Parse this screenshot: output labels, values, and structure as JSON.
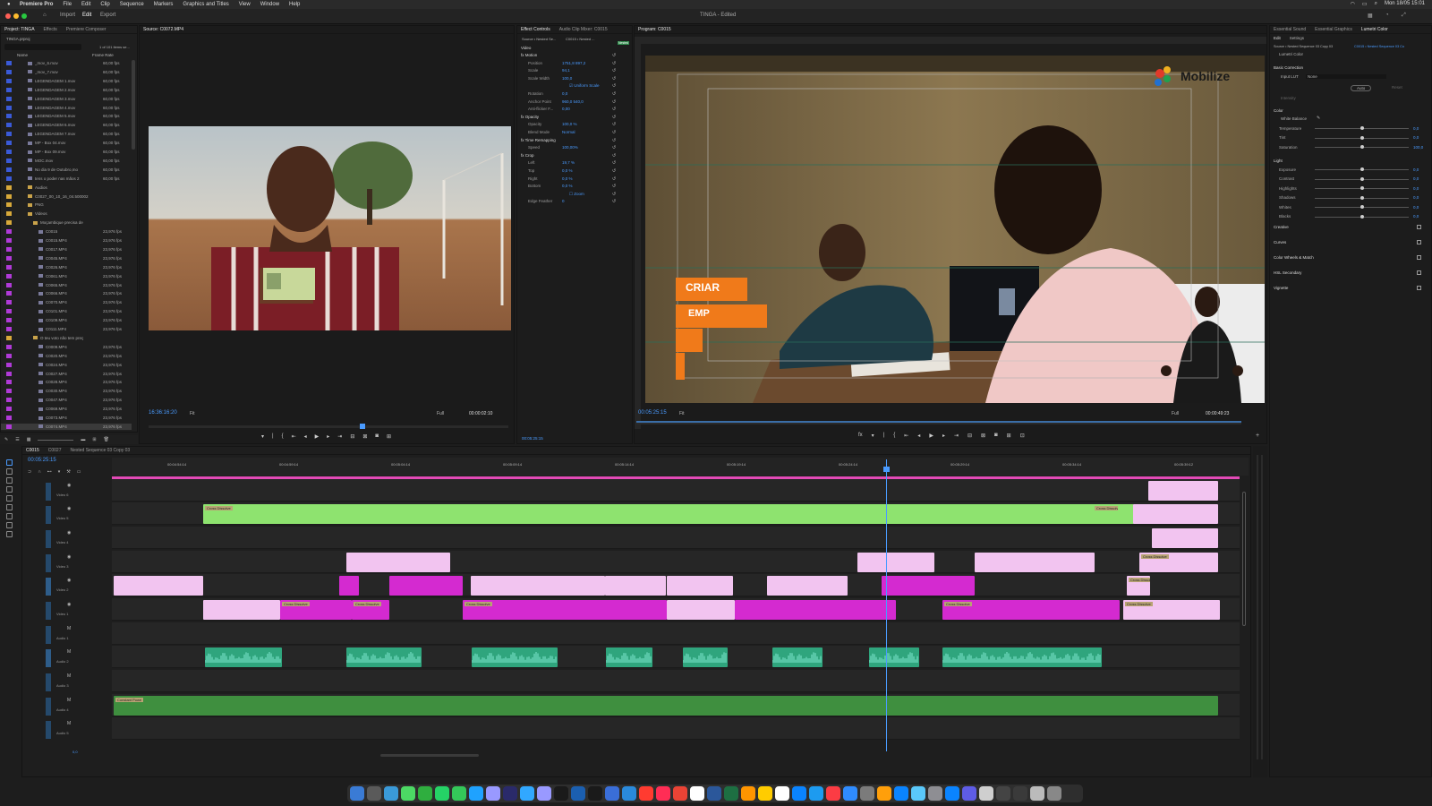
{
  "menubar": {
    "apple": "",
    "app": "Premiere Pro",
    "items": [
      "File",
      "Edit",
      "Clip",
      "Sequence",
      "Markers",
      "Graphics and Titles",
      "View",
      "Window",
      "Help"
    ],
    "clock": "Mon 18/05 15:01"
  },
  "workspace": {
    "modes": [
      "Import",
      "Edit",
      "Export"
    ],
    "active": "Edit",
    "title": "TINGA - Edited"
  },
  "project": {
    "tabs": [
      "Project: TINGA",
      "Effects",
      "Premiere Composer"
    ],
    "name": "TINGA.prproj",
    "count": "1 of 101 items se...",
    "columns": [
      "Name",
      "Frame Rate"
    ],
    "rows": [
      {
        "name": "_mov_6.mov",
        "rate": "60,00 fps",
        "color": "#3a5ad8",
        "indent": 0
      },
      {
        "name": "_mov_7.mov",
        "rate": "60,00 fps",
        "color": "#3a5ad8",
        "indent": 0
      },
      {
        "name": "LEGENDAGEM 1.mov",
        "rate": "60,00 fps",
        "color": "#3a5ad8",
        "indent": 0
      },
      {
        "name": "LEGENDAGEM 2.mov",
        "rate": "60,00 fps",
        "color": "#3a5ad8",
        "indent": 0
      },
      {
        "name": "LEGENDAGEM 3.mov",
        "rate": "60,00 fps",
        "color": "#3a5ad8",
        "indent": 0
      },
      {
        "name": "LEGENDAGEM 4.mov",
        "rate": "60,00 fps",
        "color": "#3a5ad8",
        "indent": 0
      },
      {
        "name": "LEGENDAGEM 5.mov",
        "rate": "60,00 fps",
        "color": "#3a5ad8",
        "indent": 0
      },
      {
        "name": "LEGENDAGEM 6.mov",
        "rate": "60,00 fps",
        "color": "#3a5ad8",
        "indent": 0
      },
      {
        "name": "LEGENDAGEM 7.mov",
        "rate": "60,00 fps",
        "color": "#3a5ad8",
        "indent": 0
      },
      {
        "name": "MP - Box 04.mov",
        "rate": "60,00 fps",
        "color": "#3a5ad8",
        "indent": 0
      },
      {
        "name": "MP - Box 09.mov",
        "rate": "60,00 fps",
        "color": "#3a5ad8",
        "indent": 0
      },
      {
        "name": "MOC.mov",
        "rate": "60,00 fps",
        "color": "#3a5ad8",
        "indent": 0
      },
      {
        "name": "No dia 9 de Outubro,mo",
        "rate": "60,00 fps",
        "color": "#3a5ad8",
        "indent": 0
      },
      {
        "name": "tens o poder nas mãos 2",
        "rate": "60,00 fps",
        "color": "#3a5ad8",
        "indent": 0
      },
      {
        "name": "Audios",
        "rate": "",
        "color": "#d8a93a",
        "indent": 0
      },
      {
        "name": "C0027_00_10_16_04.500002",
        "rate": "",
        "color": "#d8a93a",
        "indent": 0
      },
      {
        "name": "PNG",
        "rate": "",
        "color": "#d8a93a",
        "indent": 0
      },
      {
        "name": "Videos",
        "rate": "",
        "color": "#d8a93a",
        "indent": 0
      },
      {
        "name": "Moçambique precisa de",
        "rate": "",
        "color": "#d8a93a",
        "indent": 1
      },
      {
        "name": "C0015",
        "rate": "23,976 fps",
        "color": "#b03ad8",
        "indent": 2
      },
      {
        "name": "C0015.MP4",
        "rate": "23,976 fps",
        "color": "#b03ad8",
        "indent": 2
      },
      {
        "name": "C0017.MP4",
        "rate": "23,976 fps",
        "color": "#b03ad8",
        "indent": 2
      },
      {
        "name": "C0045.MP4",
        "rate": "23,976 fps",
        "color": "#b03ad8",
        "indent": 2
      },
      {
        "name": "C0026.MP4",
        "rate": "23,976 fps",
        "color": "#b03ad8",
        "indent": 2
      },
      {
        "name": "C0061.MP4",
        "rate": "23,976 fps",
        "color": "#b03ad8",
        "indent": 2
      },
      {
        "name": "C0065.MP4",
        "rate": "23,976 fps",
        "color": "#b03ad8",
        "indent": 2
      },
      {
        "name": "C0066.MP4",
        "rate": "23,976 fps",
        "color": "#b03ad8",
        "indent": 2
      },
      {
        "name": "C0070.MP4",
        "rate": "23,976 fps",
        "color": "#b03ad8",
        "indent": 2
      },
      {
        "name": "C0101.MP4",
        "rate": "23,976 fps",
        "color": "#b03ad8",
        "indent": 2
      },
      {
        "name": "C0109.MP4",
        "rate": "23,976 fps",
        "color": "#b03ad8",
        "indent": 2
      },
      {
        "name": "C0111.MP4",
        "rate": "23,976 fps",
        "color": "#b03ad8",
        "indent": 2
      },
      {
        "name": "O teu voto não tem preç",
        "rate": "",
        "color": "#d8a93a",
        "indent": 1
      },
      {
        "name": "C0009.MP4",
        "rate": "23,976 fps",
        "color": "#b03ad8",
        "indent": 2
      },
      {
        "name": "C0020.MP4",
        "rate": "23,976 fps",
        "color": "#b03ad8",
        "indent": 2
      },
      {
        "name": "C0024.MP4",
        "rate": "23,976 fps",
        "color": "#b03ad8",
        "indent": 2
      },
      {
        "name": "C0027.MP4",
        "rate": "23,976 fps",
        "color": "#b03ad8",
        "indent": 2
      },
      {
        "name": "C0028.MP4",
        "rate": "23,976 fps",
        "color": "#b03ad8",
        "indent": 2
      },
      {
        "name": "C0030.MP4",
        "rate": "23,976 fps",
        "color": "#b03ad8",
        "indent": 2
      },
      {
        "name": "C0047.MP4",
        "rate": "23,976 fps",
        "color": "#b03ad8",
        "indent": 2
      },
      {
        "name": "C0069.MP4",
        "rate": "23,976 fps",
        "color": "#b03ad8",
        "indent": 2
      },
      {
        "name": "C0073.MP4",
        "rate": "23,976 fps",
        "color": "#b03ad8",
        "indent": 2
      },
      {
        "name": "C0074.MP4",
        "rate": "23,976 fps",
        "color": "#b03ad8",
        "indent": 2
      }
    ]
  },
  "source": {
    "tab": "Source: C0072.MP4",
    "timecode": "16:36:16:20",
    "fit": "Fit",
    "quality": "Full",
    "duration": "00:00:02:10"
  },
  "effect_controls": {
    "tabs": [
      "Effect Controls",
      "Audio Clip Mixer: C0015"
    ],
    "source": "Source • Nested Se...",
    "seq": "C0015 • Nested ...",
    "badge": "Nested",
    "section": "Video",
    "rows": [
      {
        "label": "fx  Motion",
        "value": "",
        "level": 0
      },
      {
        "label": "Position",
        "value": "1751,8    897,2",
        "level": 1
      },
      {
        "label": "Scale",
        "value": "94,1",
        "level": 1
      },
      {
        "label": "Scale Width",
        "value": "100,0",
        "level": 1
      },
      {
        "label": "",
        "value": "☑ Uniform Scale",
        "level": 2
      },
      {
        "label": "Rotation",
        "value": "0,0",
        "level": 1
      },
      {
        "label": "Anchor Point",
        "value": "960,0    540,0",
        "level": 1
      },
      {
        "label": "Anti-flicker F...",
        "value": "0,00",
        "level": 1
      },
      {
        "label": "fx  Opacity",
        "value": "",
        "level": 0
      },
      {
        "label": "Opacity",
        "value": "100,0 %",
        "level": 1
      },
      {
        "label": "Blend Mode",
        "value": "Normal",
        "level": 1
      },
      {
        "label": "fx  Time Remapping",
        "value": "",
        "level": 0
      },
      {
        "label": "Speed",
        "value": "100,00%",
        "level": 1
      },
      {
        "label": "fx  Crop",
        "value": "",
        "level": 0
      },
      {
        "label": "Left",
        "value": "19,7 %",
        "level": 1
      },
      {
        "label": "Top",
        "value": "0,0 %",
        "level": 1
      },
      {
        "label": "Right",
        "value": "0,0 %",
        "level": 1
      },
      {
        "label": "Bottom",
        "value": "0,0 %",
        "level": 1
      },
      {
        "label": "",
        "value": "☐ Zoom",
        "level": 2
      },
      {
        "label": "Edge Feather",
        "value": "0",
        "level": 1
      }
    ],
    "timecode": "00:05:25:15"
  },
  "program": {
    "tab": "Program: C0015",
    "timecode": "00:05:25:15",
    "fit": "Fit",
    "quality": "Full",
    "duration": "00:00:49:23",
    "logo_text": "Mobilize",
    "lower_third": [
      "CRIAR",
      "EMP"
    ]
  },
  "lumetri": {
    "tabs": [
      "Essential Sound",
      "Essential Graphics",
      "Lumetri Color"
    ],
    "subtabs": [
      "Edit",
      "Settings"
    ],
    "clip": "Source • Nested Sequence 03 Copy 03",
    "seqclip": "C0015 • Nested Sequence 03 Co",
    "effect": "Lumetri Color",
    "basic": "Basic Correction",
    "input_lut_label": "Input LUT",
    "input_lut_value": "None",
    "auto": "Auto",
    "reset": "Reset",
    "intensity": "Intensity",
    "color_header": "Color",
    "white_balance": "White Balance",
    "color_rows": [
      {
        "label": "Temperature",
        "value": "0,0",
        "pos": 0.5
      },
      {
        "label": "Tint",
        "value": "0,0",
        "pos": 0.5
      },
      {
        "label": "Saturation",
        "value": "100,0",
        "pos": 0.5
      }
    ],
    "light_header": "Light",
    "light_rows": [
      {
        "label": "Exposure",
        "value": "0,0",
        "pos": 0.5
      },
      {
        "label": "Contrast",
        "value": "0,0",
        "pos": 0.5
      },
      {
        "label": "Highlights",
        "value": "0,0",
        "pos": 0.5
      },
      {
        "label": "Shadows",
        "value": "0,0",
        "pos": 0.5
      },
      {
        "label": "Whites",
        "value": "0,0",
        "pos": 0.5
      },
      {
        "label": "Blacks",
        "value": "0,0",
        "pos": 0.5
      }
    ],
    "sections": [
      "Creative",
      "Curves",
      "Color Wheels & Match",
      "HSL Secondary",
      "Vignette"
    ]
  },
  "timeline": {
    "tabs": [
      "C0015",
      "C0027",
      "Nested Sequence 03 Copy 03"
    ],
    "timecode": "00:05:25:15",
    "ruler": [
      "00:04:54:14",
      "00:04:59:14",
      "00:05:04:14",
      "00:05:09:14",
      "00:05:14:14",
      "00:05:19:14",
      "00:05:24:14",
      "00:05:29:14",
      "00:05:34:14",
      "00:05:39:12"
    ],
    "tracks": [
      "Video 6",
      "Video 5",
      "Video 4",
      "Video 3",
      "Video 2",
      "Video 1",
      "Audio 1",
      "Audio 2",
      "Audio 3",
      "Audio 4",
      "Audio 5"
    ],
    "clip_labels": {
      "cross": "Cross Dissolve",
      "const": "Constant Powe"
    },
    "end_value": "0,0"
  },
  "colors": {
    "accent": "#4a9bff",
    "green_clip": "#8ee36f",
    "pink_clip": "#f2c4f0",
    "magenta_clip": "#d42ad0",
    "audio_clip": "#2fa57d",
    "orange": "#f07a1a"
  }
}
